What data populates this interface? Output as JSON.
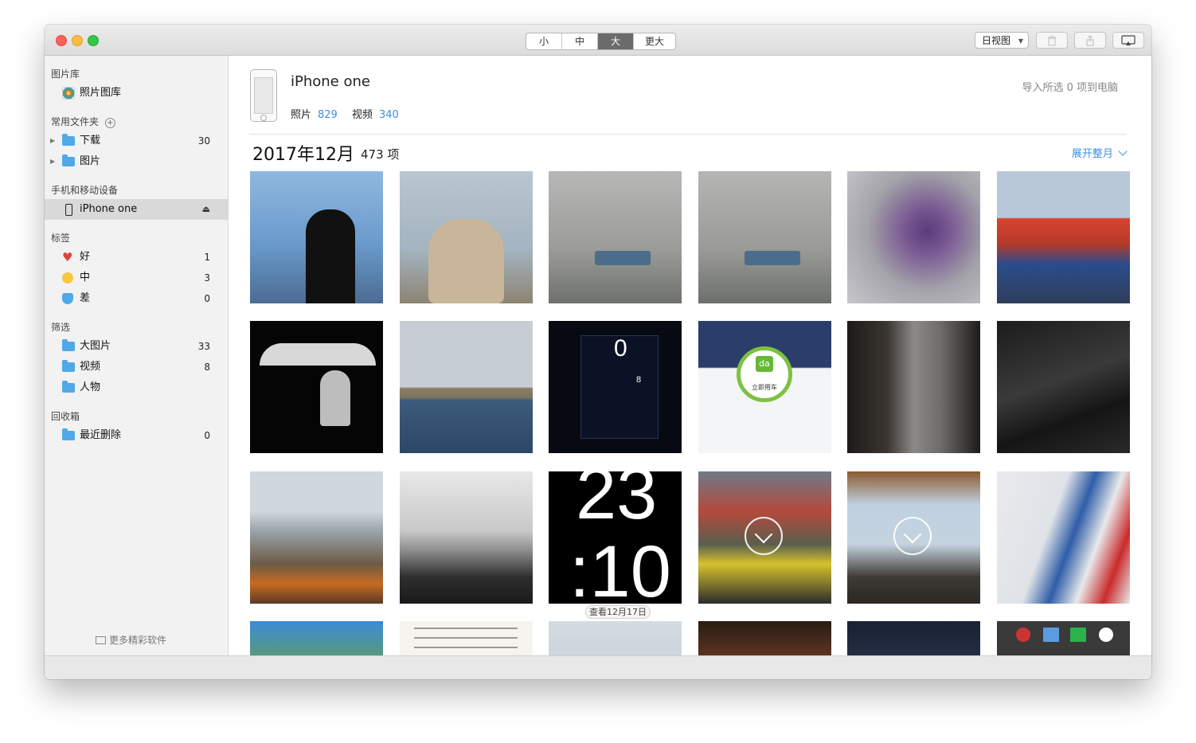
{
  "toolbar": {
    "sizes": [
      "小",
      "中",
      "大",
      "更大"
    ],
    "active_size": "大",
    "view_select": "日视图",
    "icons": [
      "trash-icon",
      "share-icon",
      "airplay-icon"
    ]
  },
  "sidebar": {
    "library_header": "图片库",
    "library_item": "照片图库",
    "favorites_header": "常用文件夹",
    "favorites": [
      {
        "label": "下载",
        "count": "30"
      },
      {
        "label": "图片",
        "count": ""
      }
    ],
    "devices_header": "手机和移动设备",
    "device": "iPhone one",
    "tags_header": "标签",
    "tags": [
      {
        "label": "好",
        "count": "1"
      },
      {
        "label": "中",
        "count": "3"
      },
      {
        "label": "差",
        "count": "0"
      }
    ],
    "filters_header": "筛选",
    "filters": [
      {
        "label": "大图片",
        "count": "33"
      },
      {
        "label": "视频",
        "count": "8"
      },
      {
        "label": "人物",
        "count": ""
      }
    ],
    "trash_header": "回收箱",
    "trash": {
      "label": "最近删除",
      "count": "0"
    },
    "more": "更多精彩软件"
  },
  "device": {
    "name": "iPhone one",
    "photos_label": "照片",
    "photos_count": "829",
    "videos_label": "视频",
    "videos_count": "340",
    "import_label": "导入所选 0 项到电脑"
  },
  "section": {
    "month": "2017年12月",
    "count": "473 项",
    "expand": "展开整月"
  },
  "thumbs": {
    "clock_hour": "23",
    "clock_min": ":10",
    "date_badge": "查看12月17日",
    "app_text": "立即用车",
    "app_logo": "da",
    "tile_labels": [
      "8",
      "0"
    ]
  },
  "colors": {
    "accent": "#3d8fe0",
    "selected_segment": "#6b6b6b",
    "sidebar_bg": "#f2f2f2"
  }
}
